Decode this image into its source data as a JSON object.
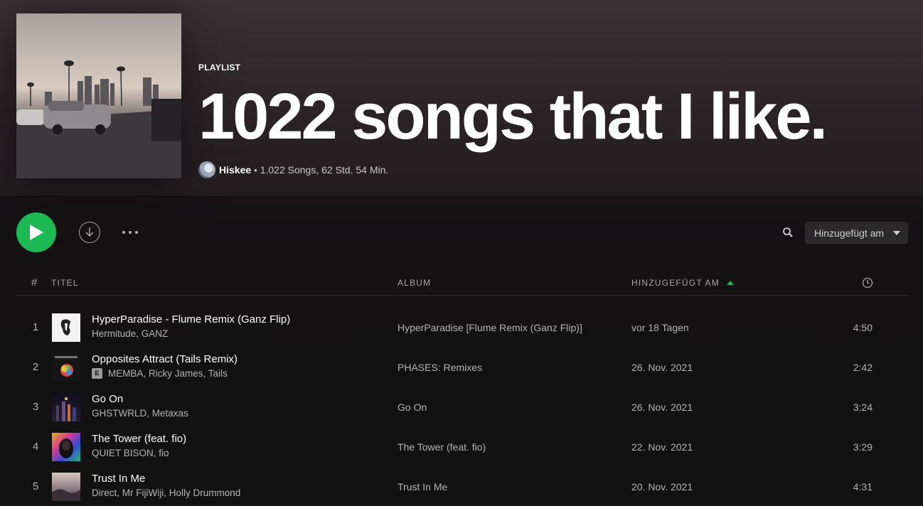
{
  "playlist": {
    "type_label": "PLAYLIST",
    "title": "1022 songs that I like.",
    "owner": "Hiskee",
    "separator": "•",
    "stats": "1.022 Songs, 62 Std. 54 Min."
  },
  "actions": {
    "play_icon": "play-icon",
    "download_icon": "download-icon",
    "more_icon": "more-icon",
    "search_icon": "search-icon",
    "sort_label": "Hinzugefügt am"
  },
  "table": {
    "headers": {
      "number": "#",
      "title": "TITEL",
      "album": "ALBUM",
      "added": "HINZUGEFÜGT AM",
      "duration_icon": "clock-icon"
    },
    "rows": [
      {
        "number": "1",
        "title": "HyperParadise - Flume Remix (Ganz Flip)",
        "artists": "Hermitude, GANZ",
        "explicit": false,
        "album": "HyperParadise [Flume Remix (Ganz Flip)]",
        "added": "vor 18 Tagen",
        "duration": "4:50"
      },
      {
        "number": "2",
        "title": "Opposites Attract (Tails Remix)",
        "artists": "MEMBA, Ricky James, Tails",
        "explicit": true,
        "explicit_label": "E",
        "album": "PHASES: Remixes",
        "added": "26. Nov. 2021",
        "duration": "2:42"
      },
      {
        "number": "3",
        "title": "Go On",
        "artists": "GHSTWRLD, Metaxas",
        "explicit": false,
        "album": "Go On",
        "added": "26. Nov. 2021",
        "duration": "3:24"
      },
      {
        "number": "4",
        "title": "The Tower (feat. fio)",
        "artists": "QUIET BISON, fio",
        "explicit": false,
        "album": "The Tower (feat. fio)",
        "added": "22. Nov. 2021",
        "duration": "3:29"
      },
      {
        "number": "5",
        "title": "Trust In Me",
        "artists": "Direct, Mr FijiWiji, Holly Drummond",
        "explicit": false,
        "album": "Trust In Me",
        "added": "20. Nov. 2021",
        "duration": "4:31"
      }
    ]
  },
  "colors": {
    "accent": "#1db954",
    "background": "#121212",
    "text_secondary": "#b3b3b3"
  }
}
